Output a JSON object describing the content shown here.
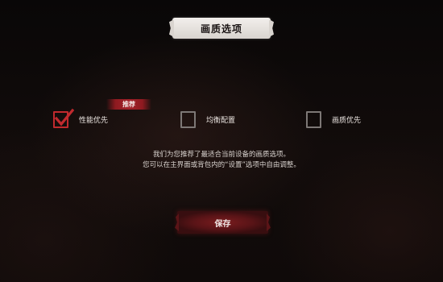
{
  "dialog": {
    "title": "画质选项",
    "recommend_tag": "推荐",
    "options": [
      {
        "label": "性能优先",
        "checked": true
      },
      {
        "label": "均衡配置",
        "checked": false
      },
      {
        "label": "画质优先",
        "checked": false
      }
    ],
    "info_line1": "我们为您推荐了最适合当前设备的画质选项。",
    "info_line2": "您可以在主界面或背包内的“设置”选项中自由调整。",
    "save_label": "保存"
  },
  "colors": {
    "accent_red": "#c02a2e",
    "button_red": "#5a1417",
    "background": "#0c0909"
  }
}
